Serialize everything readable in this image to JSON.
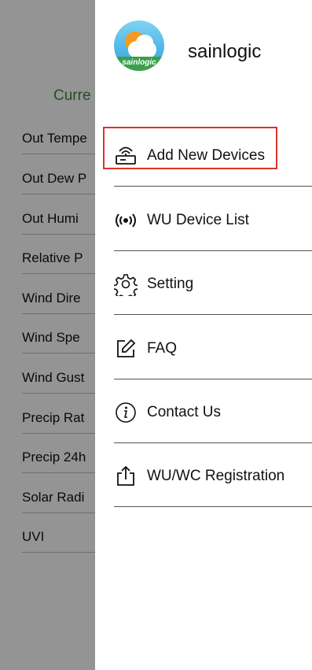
{
  "background": {
    "section_title": "Curre",
    "rows": [
      "Out Tempe",
      "Out Dew P",
      "Out Humi",
      "Relative P",
      "Wind Dire",
      "Wind Spe",
      "Wind Gust",
      "Precip Rat",
      "Precip 24h",
      "Solar Radi",
      "UVI"
    ]
  },
  "drawer": {
    "logo_text": "sainlogic",
    "brand": "sainlogic",
    "menu": [
      {
        "label": "Add New Devices",
        "icon": "router-icon"
      },
      {
        "label": "WU Device List",
        "icon": "broadcast-icon"
      },
      {
        "label": "Setting",
        "icon": "gear-icon"
      },
      {
        "label": "FAQ",
        "icon": "edit-icon"
      },
      {
        "label": "Contact Us",
        "icon": "info-icon"
      },
      {
        "label": "WU/WC Registration",
        "icon": "upload-icon"
      }
    ],
    "highlight_color": "#d9352c"
  }
}
